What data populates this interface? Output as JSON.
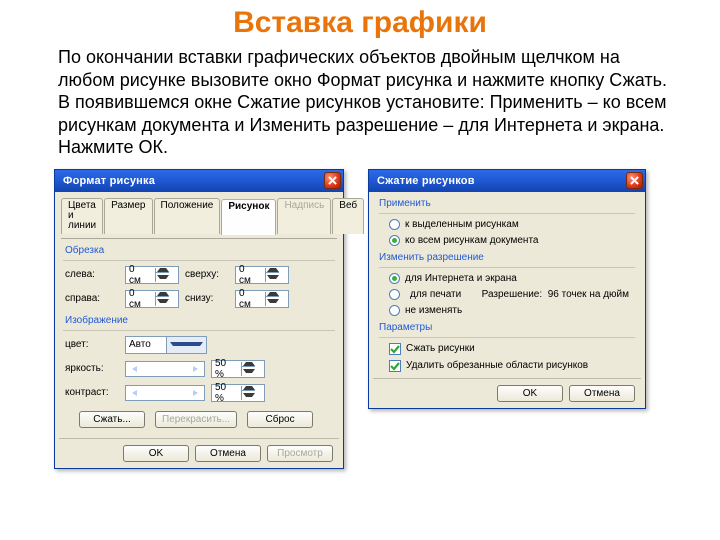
{
  "headline": "Вставка графики",
  "paragraph": "По окончании вставки графических объектов двойным щелчком на любом рисунке вызовите окно Формат рисунка и нажмите кнопку Сжать. В появившемся окне Сжатие рисунков установите: Применить – ко всем рисункам документа и Изменить разрешение – для Интернета и экрана. Нажмите ОК.",
  "dlg1": {
    "title": "Формат рисунка",
    "tabs": [
      "Цвета и линии",
      "Размер",
      "Положение",
      "Рисунок",
      "Надпись",
      "Веб"
    ],
    "active_tab": 3,
    "disabled_tab": 4,
    "sections": {
      "crop": "Обрезка",
      "image": "Изображение"
    },
    "crop": {
      "left_label": "слева:",
      "left_value": "0 см",
      "right_label": "справа:",
      "right_value": "0 см",
      "top_label": "сверху:",
      "top_value": "0 см",
      "bottom_label": "снизу:",
      "bottom_value": "0 см"
    },
    "image": {
      "color_label": "цвет:",
      "color_value": "Авто",
      "brightness_label": "яркость:",
      "brightness_value": "50 %",
      "contrast_label": "контраст:",
      "contrast_value": "50 %"
    },
    "buttons": {
      "compress": "Сжать...",
      "recolor": "Перекрасить...",
      "reset": "Сброс",
      "ok": "OK",
      "cancel": "Отмена",
      "preview": "Просмотр"
    }
  },
  "dlg2": {
    "title": "Сжатие рисунков",
    "sections": {
      "apply": "Применить",
      "resolution": "Изменить разрешение",
      "params": "Параметры"
    },
    "apply": {
      "selected": "к выделенным рисункам",
      "all": "ко всем рисункам документа"
    },
    "resolution": {
      "web": "для Интернета и экрана",
      "print": "для печати",
      "none": "не изменять",
      "res_label": "Разрешение:",
      "res_value": "96 точек на дюйм"
    },
    "params": {
      "compress": "Сжать рисунки",
      "deletecrop": "Удалить обрезанные области рисунков"
    },
    "buttons": {
      "ok": "OK",
      "cancel": "Отмена"
    }
  }
}
